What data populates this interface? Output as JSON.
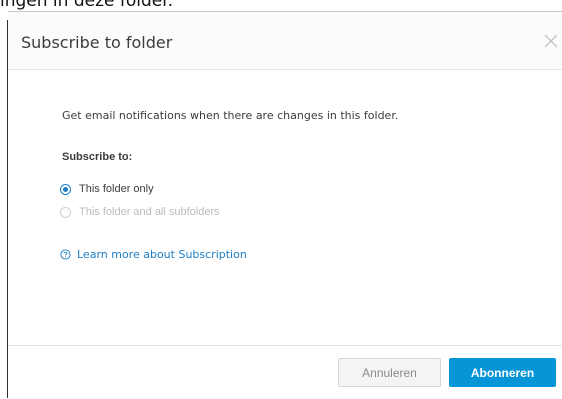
{
  "background": {
    "partial_text": "ingen in deze folder."
  },
  "dialog": {
    "title": "Subscribe to folder",
    "description": "Get email notifications when there are changes in this folder.",
    "subscribe_label": "Subscribe to:",
    "options": [
      {
        "label": "This folder only",
        "checked": true,
        "disabled": false
      },
      {
        "label": "This folder and all subfolders",
        "checked": false,
        "disabled": true
      }
    ],
    "learn_more": "Learn more about Subscription",
    "buttons": {
      "cancel": "Annuleren",
      "confirm": "Abonneren"
    }
  },
  "colors": {
    "accent": "#0696d7",
    "link": "#1f7ec6",
    "disabled_text": "#bcbcbc"
  }
}
